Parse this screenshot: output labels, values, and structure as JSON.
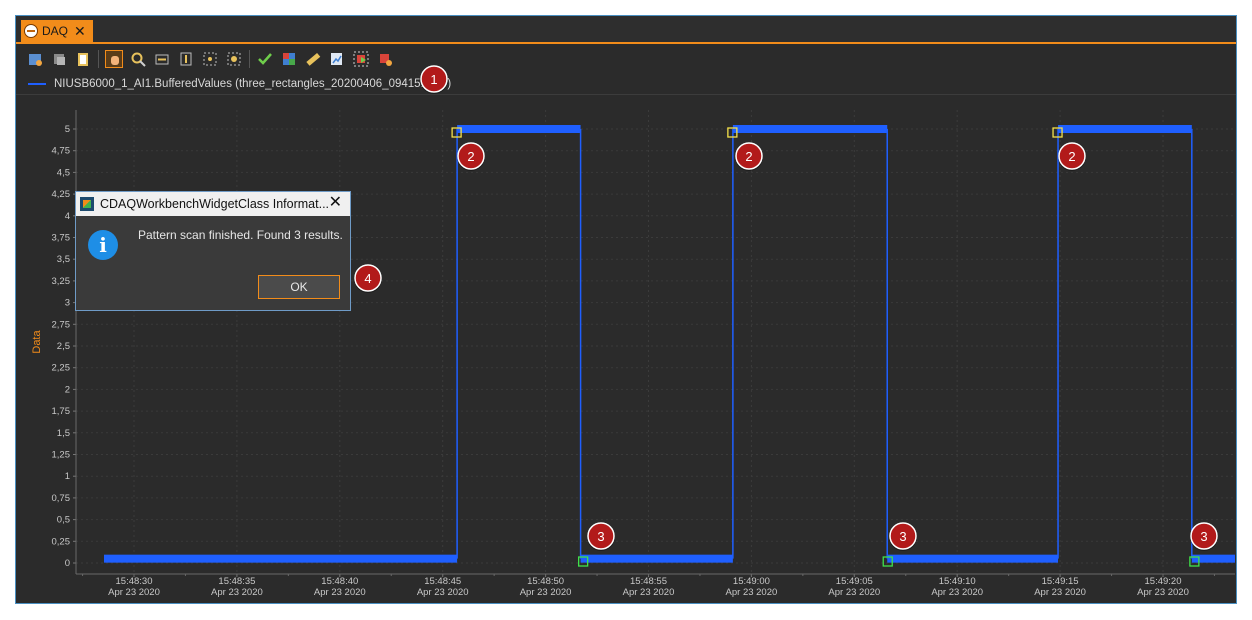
{
  "tab": {
    "label": "DAQ",
    "close": "✕"
  },
  "toolbar": {
    "icons": [
      "settings-gear-icon",
      "cube-icon",
      "clipboard-icon",
      "hand-pan-icon",
      "zoom-icon",
      "fit-horizontal-icon",
      "fit-vertical-icon",
      "fit-all-icon",
      "center-icon",
      "checkmark-icon",
      "grid-heatmap-icon",
      "ruler-icon",
      "export-chart-icon",
      "pattern-scan-icon",
      "pattern-scan-settings-icon"
    ],
    "active": "hand-pan-icon"
  },
  "legend": {
    "label": "NIUSB6000_1_AI1.BufferedValues (three_rectangles_20200406_094151.csv)"
  },
  "chart_data": {
    "type": "line",
    "ylabel": "Data",
    "ylim": [
      0,
      5.2
    ],
    "yticks": [
      "0",
      "0,25",
      "0,5",
      "0,75",
      "1",
      "1,25",
      "1,5",
      "1,75",
      "2",
      "2,25",
      "2,5",
      "2,75",
      "3",
      "3,25",
      "3,5",
      "3,75",
      "4",
      "4,25",
      "4,5",
      "4,75",
      "5"
    ],
    "xticks": [
      {
        "time": "15:48:30",
        "date": "Apr 23 2020"
      },
      {
        "time": "15:48:35",
        "date": "Apr 23 2020"
      },
      {
        "time": "15:48:40",
        "date": "Apr 23 2020"
      },
      {
        "time": "15:48:45",
        "date": "Apr 23 2020"
      },
      {
        "time": "15:48:50",
        "date": "Apr 23 2020"
      },
      {
        "time": "15:48:55",
        "date": "Apr 23 2020"
      },
      {
        "time": "15:49:00",
        "date": "Apr 23 2020"
      },
      {
        "time": "15:49:05",
        "date": "Apr 23 2020"
      },
      {
        "time": "15:49:10",
        "date": "Apr 23 2020"
      },
      {
        "time": "15:49:15",
        "date": "Apr 23 2020"
      },
      {
        "time": "15:49:20",
        "date": "Apr 23 2020"
      }
    ],
    "series": [
      {
        "color": "#1f5fff",
        "signal_low": 0.05,
        "signal_high": 5.0,
        "segments_sec": [
          {
            "from": 28.5,
            "to": 45.7,
            "level": "low"
          },
          {
            "from": 45.7,
            "to": 51.7,
            "level": "high"
          },
          {
            "from": 51.7,
            "to": 59.1,
            "level": "low"
          },
          {
            "from": 59.1,
            "to": 66.6,
            "level": "high"
          },
          {
            "from": 66.6,
            "to": 74.9,
            "level": "low"
          },
          {
            "from": 74.9,
            "to": 81.4,
            "level": "high"
          },
          {
            "from": 81.4,
            "to": 84.0,
            "level": "low"
          }
        ]
      }
    ],
    "pattern_start_markers_sec": [
      45.7,
      59.1,
      74.9
    ],
    "pattern_end_markers_sec": [
      51.8,
      66.6,
      81.5
    ],
    "grid": true
  },
  "annotations": [
    "1",
    "2",
    "2",
    "2",
    "3",
    "3",
    "3",
    "4"
  ],
  "dialog": {
    "title": "CDAQWorkbenchWidgetClass Informat...",
    "close": "✕",
    "icon": "i",
    "message": "Pattern scan finished. Found 3 results.",
    "ok_label": "OK"
  }
}
